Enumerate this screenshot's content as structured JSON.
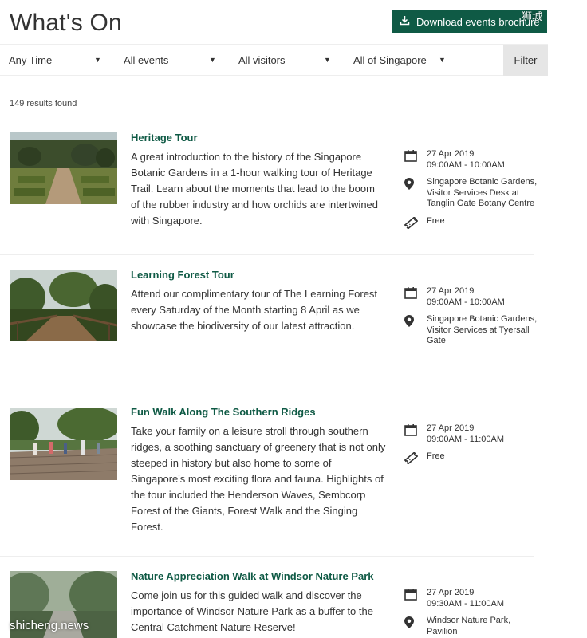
{
  "page": {
    "title": "What's On"
  },
  "header": {
    "download_label": "Download events brochure"
  },
  "filters": {
    "time": "Any Time",
    "events": "All events",
    "visitors": "All visitors",
    "location": "All of Singapore",
    "filter_label": "Filter"
  },
  "results": {
    "count_text": "149 results found"
  },
  "events": [
    {
      "title": "Heritage Tour",
      "description": "A great introduction to the history of the Singapore Botanic Gardens in a 1-hour walking tour of Heritage Trail. Learn about the moments that lead to the boom of the rubber industry and how orchids are intertwined with Singapore.",
      "date": "27 Apr 2019",
      "time": "09:00AM - 10:00AM",
      "location": "Singapore Botanic Gardens, Visitor Services Desk at Tanglin Gate Botany Centre",
      "price": "Free"
    },
    {
      "title": "Learning Forest Tour",
      "description": "Attend our complimentary tour of The Learning Forest every Saturday of the Month starting 8 April as we showcase the biodiversity of our latest attraction.",
      "date": "27 Apr 2019",
      "time": "09:00AM - 10:00AM",
      "location": "Singapore Botanic Gardens, Visitor Services at Tyersall Gate"
    },
    {
      "title": "Fun Walk Along The Southern Ridges",
      "description": "Take your family on a leisure stroll through southern ridges, a soothing sanctuary of greenery that is not only steeped in history but also home to some of Singapore's most exciting flora and fauna. Highlights of the tour included the Henderson Waves, Sembcorp Forest of the Giants, Forest Walk and the Singing Forest.",
      "date": "27 Apr 2019",
      "time": "09:00AM - 11:00AM",
      "price": "Free"
    },
    {
      "title": "Nature Appreciation Walk at Windsor Nature Park",
      "description": "Come join us for this guided walk and discover the importance of Windsor Nature Park as a buffer to the Central Catchment Nature Reserve!",
      "date": "27 Apr 2019",
      "time": "09:30AM - 11:00AM",
      "location": "Windsor Nature Park, Pavilion"
    }
  ],
  "watermarks": {
    "top": "狮城",
    "bottom": "shicheng.news"
  },
  "colors": {
    "brand_green": "#0f5a45",
    "filter_bg": "#e6e6e6"
  }
}
